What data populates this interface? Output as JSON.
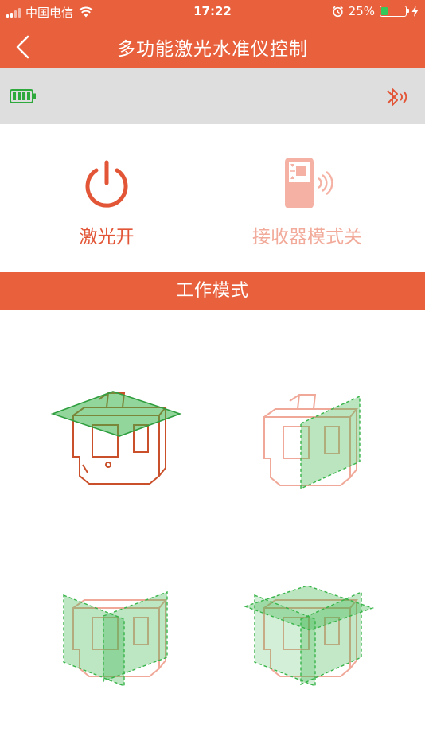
{
  "status_bar": {
    "carrier": "中国电信",
    "time": "17:22",
    "battery_percent": "25%",
    "icons": [
      "signal-icon",
      "wifi-icon",
      "alarm-icon",
      "battery-icon",
      "charging-icon"
    ]
  },
  "nav": {
    "title": "多功能激光水准仪控制",
    "back_icon": "chevron-left-icon"
  },
  "device_bar": {
    "icons": [
      "device-battery-icon",
      "bluetooth-icon"
    ],
    "battery_color": "#2eaa3c"
  },
  "controls": {
    "laser": {
      "label": "激光开",
      "icon": "power-icon",
      "state": "on"
    },
    "receiver": {
      "label": "接收器模式关",
      "icon": "receiver-icon",
      "state": "off"
    }
  },
  "section": {
    "title": "工作模式"
  },
  "modes": [
    {
      "name": "horizontal-plane",
      "active": true
    },
    {
      "name": "vertical-side-plane",
      "active": false
    },
    {
      "name": "dual-vertical-plane",
      "active": false
    },
    {
      "name": "all-planes",
      "active": false
    }
  ],
  "colors": {
    "accent": "#e8603c",
    "active_line": "#c9502a",
    "inactive_line": "#f0a898",
    "plane_green": "#38b449",
    "device_bar_bg": "#dedede"
  }
}
